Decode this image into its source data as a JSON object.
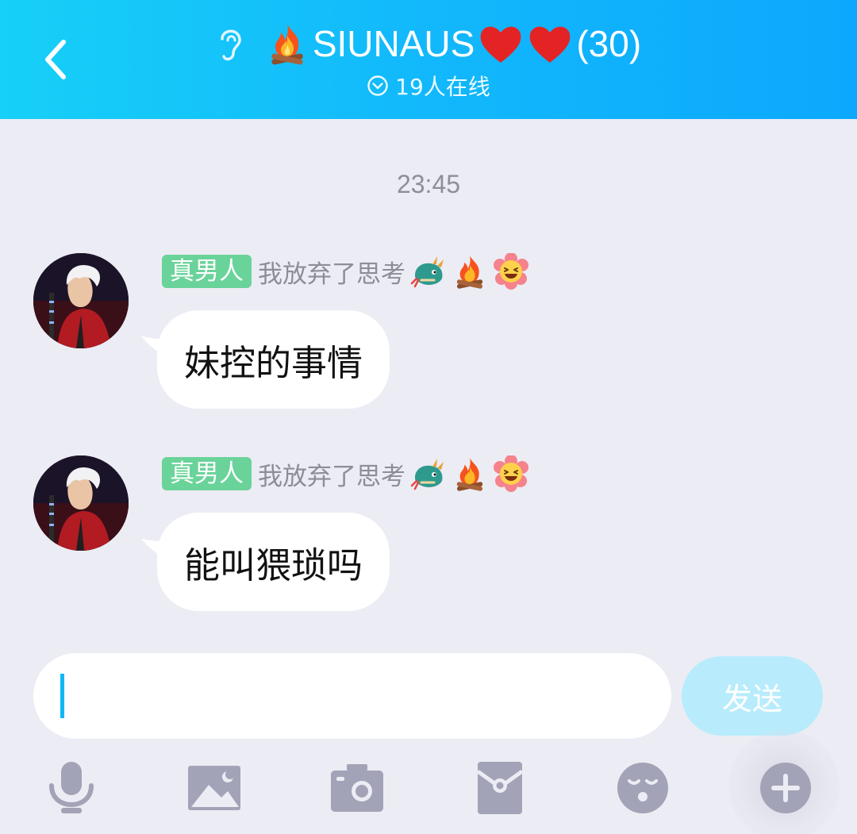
{
  "header": {
    "title": "SIUNAUS",
    "member_count": "(30)",
    "online_text": "19人在线"
  },
  "chat": {
    "timestamp": "23:45",
    "messages": [
      {
        "title_badge": "真男人",
        "nickname": "我放弃了思考",
        "text": "妹控的事情"
      },
      {
        "title_badge": "真男人",
        "nickname": "我放弃了思考",
        "text": "能叫猥琐吗"
      }
    ]
  },
  "input": {
    "value": "",
    "send_label": "发送"
  },
  "toolbar": {
    "items": [
      "microphone-icon",
      "image-icon",
      "camera-icon",
      "red-packet-icon",
      "emoji-icon",
      "plus-icon"
    ]
  },
  "colors": {
    "header_start": "#16d0f8",
    "header_end": "#0ca8fd",
    "title_badge": "#6ad39a",
    "send_button": "#b8ecfc",
    "caret": "#12b7f5",
    "icon_gray": "#a2a3b6"
  }
}
